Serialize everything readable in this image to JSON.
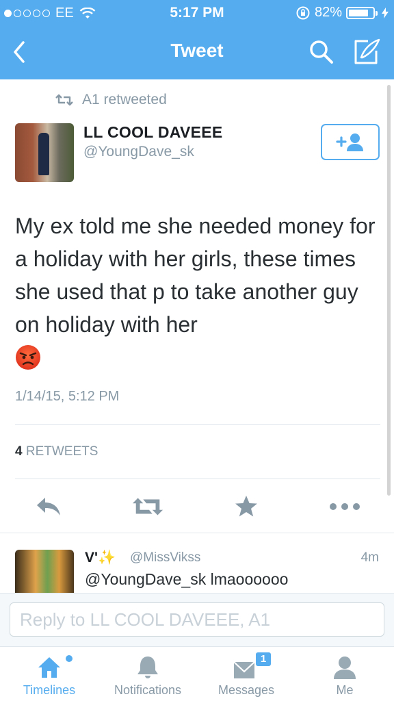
{
  "status_bar": {
    "carrier": "EE",
    "time": "5:17 PM",
    "battery": "82%",
    "battery_level": 0.82,
    "signal_bars_filled": 1,
    "signal_bars_total": 5
  },
  "nav": {
    "title": "Tweet",
    "back_icon": "chevron-left-icon",
    "search_icon": "search-icon",
    "compose_icon": "compose-icon"
  },
  "tweet": {
    "retweeted_by": "A1 retweeted",
    "author_name": "LL COOL DAVEEE",
    "author_handle": "@YoungDave_sk",
    "text": "My ex told me she needed money for a holiday with her girls, these times she used that p to take another guy on holiday with her",
    "emoji": "angry-face-emoji",
    "timestamp": "1/14/15, 5:12 PM",
    "retweet_count": "4",
    "retweets_label": "RETWEETS"
  },
  "reply": {
    "name": "V'✨",
    "handle": "@MissVikss",
    "time": "4m",
    "text": "@YoungDave_sk lmaoooooo"
  },
  "reply_box": {
    "placeholder": "Reply to LL COOL DAVEEE, A1"
  },
  "tabs": [
    {
      "label": "Timelines",
      "icon": "home-icon",
      "active": true
    },
    {
      "label": "Notifications",
      "icon": "bell-icon",
      "active": false
    },
    {
      "label": "Messages",
      "icon": "envelope-icon",
      "badge": "1",
      "active": false
    },
    {
      "label": "Me",
      "icon": "person-icon",
      "active": false
    }
  ],
  "colors": {
    "brand_blue": "#55acee",
    "muted_gray": "#8899a6",
    "text_dark": "#292f33"
  }
}
